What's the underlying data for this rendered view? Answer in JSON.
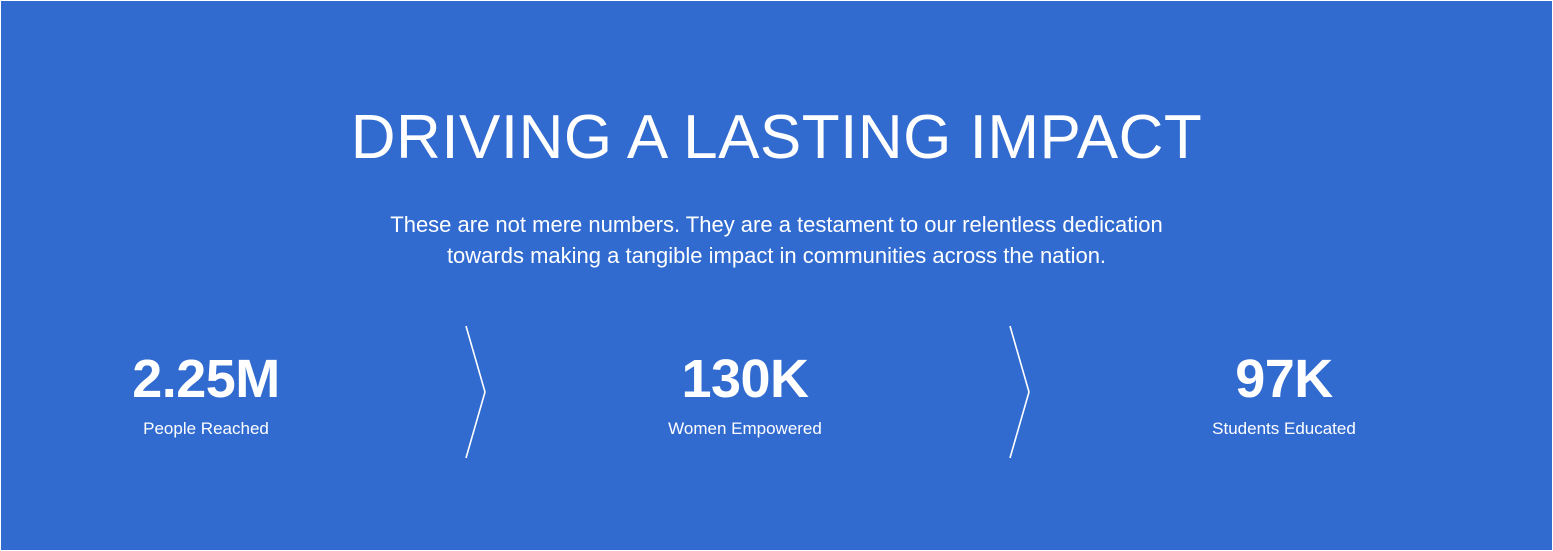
{
  "section": {
    "title": "DRIVING A LASTING IMPACT",
    "subtitle_lines": [
      "These are not mere numbers. They are a testament to our relentless dedication",
      "towards making a tangible impact in communities across the nation."
    ],
    "background_color": "#316bd0",
    "text_color": "#ffffff"
  },
  "stats": [
    {
      "value": "2.25M",
      "label": "People Reached"
    },
    {
      "value": "130K",
      "label": "Women Empowered"
    },
    {
      "value": "97K",
      "label": "Students Educated"
    }
  ],
  "separators": [
    "chevron-right-icon",
    "chevron-right-icon"
  ]
}
